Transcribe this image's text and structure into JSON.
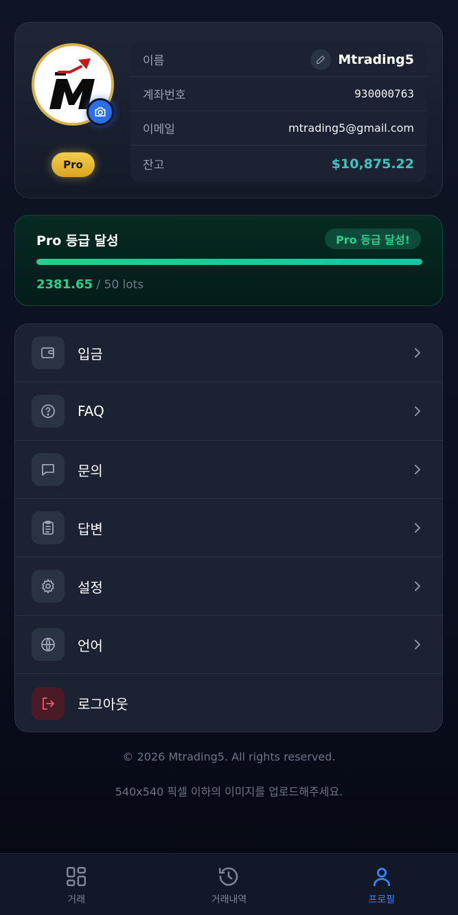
{
  "profile": {
    "tier_badge": "Pro",
    "rows": {
      "name_label": "이름",
      "name_value": "Mtrading5",
      "account_label": "계좌번호",
      "account_value": "930000763",
      "email_label": "이메일",
      "email_value": "mtrading5@gmail.com",
      "balance_label": "잔고",
      "balance_value": "$10,875.22"
    }
  },
  "tier": {
    "title": "Pro 등급 달성",
    "status_pill": "Pro 등급 달성!",
    "progress_fraction": 1.0,
    "current_lots": "2381.65",
    "target_lots": " / 50 lots"
  },
  "menu": {
    "items": [
      {
        "label": "입금",
        "icon": "wallet-icon"
      },
      {
        "label": "FAQ",
        "icon": "help-circle-icon"
      },
      {
        "label": "문의",
        "icon": "chat-icon"
      },
      {
        "label": "답변",
        "icon": "clipboard-icon"
      },
      {
        "label": "설정",
        "icon": "gear-icon"
      },
      {
        "label": "언어",
        "icon": "globe-icon"
      },
      {
        "label": "로그아웃",
        "icon": "logout-icon"
      }
    ]
  },
  "footer": {
    "copyright": "© 2026 Mtrading5. All rights reserved.",
    "note": "540x540 픽셀 이하의 이미지를 업로드해주세요."
  },
  "nav": {
    "items": [
      {
        "label": "거래",
        "icon": "grid-icon"
      },
      {
        "label": "거래내역",
        "icon": "history-icon"
      },
      {
        "label": "프로필",
        "icon": "user-icon"
      }
    ],
    "active": "프로필"
  },
  "colors": {
    "accent_blue": "#3b82f6",
    "pro_gold": "#f3cc4e",
    "tier_green": "#2ecf8e",
    "balance_teal": "#3fc5c0",
    "logout_red": "#f05a6a"
  }
}
